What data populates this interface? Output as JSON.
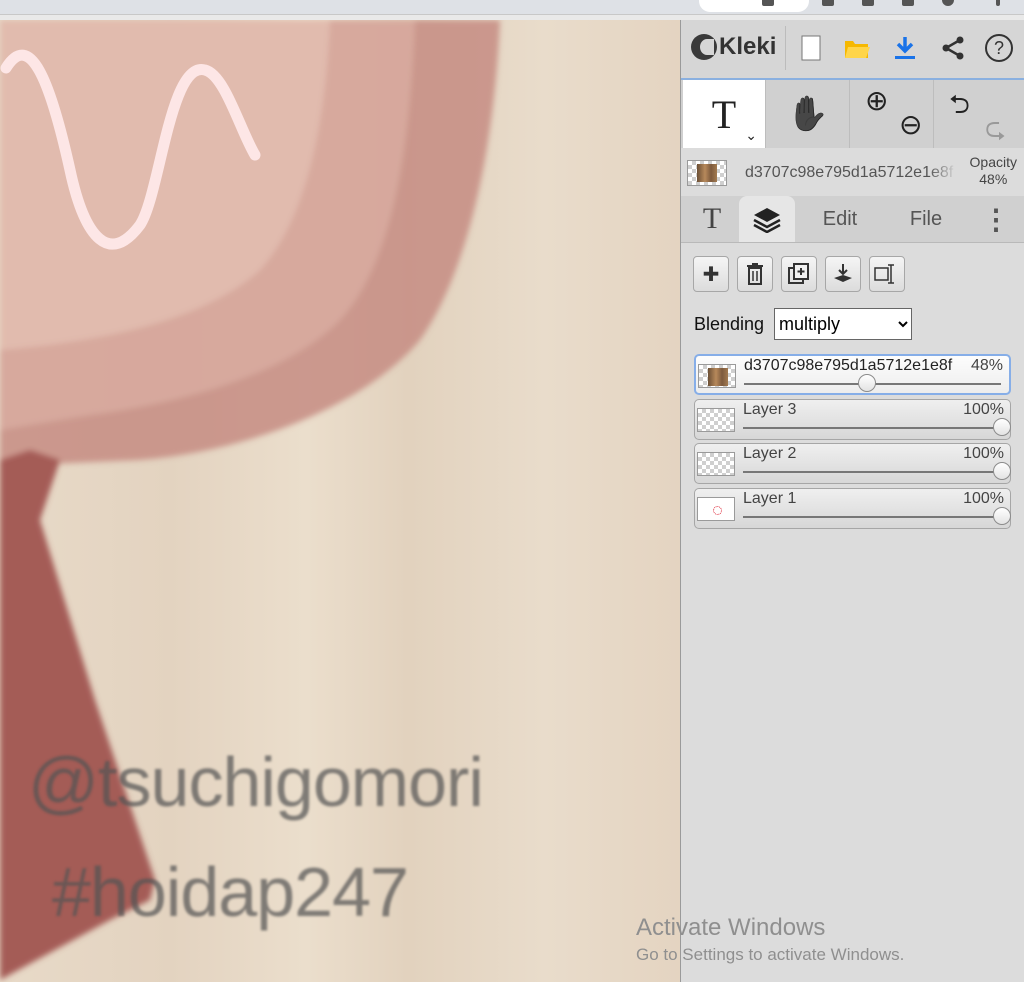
{
  "app": {
    "logo_text": "Kleki",
    "toolbar_icons": [
      "new-file-icon",
      "open-folder-icon",
      "download-icon",
      "share-icon",
      "help-icon"
    ]
  },
  "tools": {
    "text_tool_glyph": "T",
    "text_tool_chevron": "⌄",
    "hand_glyph": "✋",
    "zoom_in_glyph": "⊕",
    "zoom_out_glyph": "⊖",
    "undo_glyph": "⮌",
    "redo_glyph": "⮎"
  },
  "current_layer": {
    "name": "d3707c98e795d1a5712e1e8f",
    "opacity_label": "Opacity",
    "opacity_value": "48%"
  },
  "tabs": {
    "brush": "T",
    "layers_icon": "layers-icon",
    "edit": "Edit",
    "file": "File",
    "more": "⋮"
  },
  "layer_buttons": {
    "add": "✚",
    "delete": "🗑",
    "duplicate": "⧉",
    "merge": "⤓",
    "rename": "⌶"
  },
  "blending": {
    "label": "Blending",
    "value": "multiply"
  },
  "layers": [
    {
      "name": "d3707c98e795d1a5712e1e8f",
      "opacity_label": "48%",
      "opacity": 0.48,
      "active": true,
      "thumb": "image"
    },
    {
      "name": "Layer 3",
      "opacity_label": "100%",
      "opacity": 1.0,
      "active": false,
      "thumb": "empty"
    },
    {
      "name": "Layer 2",
      "opacity_label": "100%",
      "opacity": 1.0,
      "active": false,
      "thumb": "empty"
    },
    {
      "name": "Layer 1",
      "opacity_label": "100%",
      "opacity": 1.0,
      "active": false,
      "thumb": "sketch"
    }
  ],
  "canvas": {
    "watermark_line1": "@tsuchigomori",
    "watermark_line2": "#hoidap247"
  },
  "os_overlay": {
    "line1": "Activate Windows",
    "line2": "Go to Settings to activate Windows."
  },
  "colors": {
    "accent": "#1a73e8",
    "folder": "#f6b800",
    "canvas_bg": "#e5d7c4",
    "stroke_dark": "#a8605b",
    "stroke_light": "#c98a84",
    "squiggle": "#fde6e6"
  }
}
